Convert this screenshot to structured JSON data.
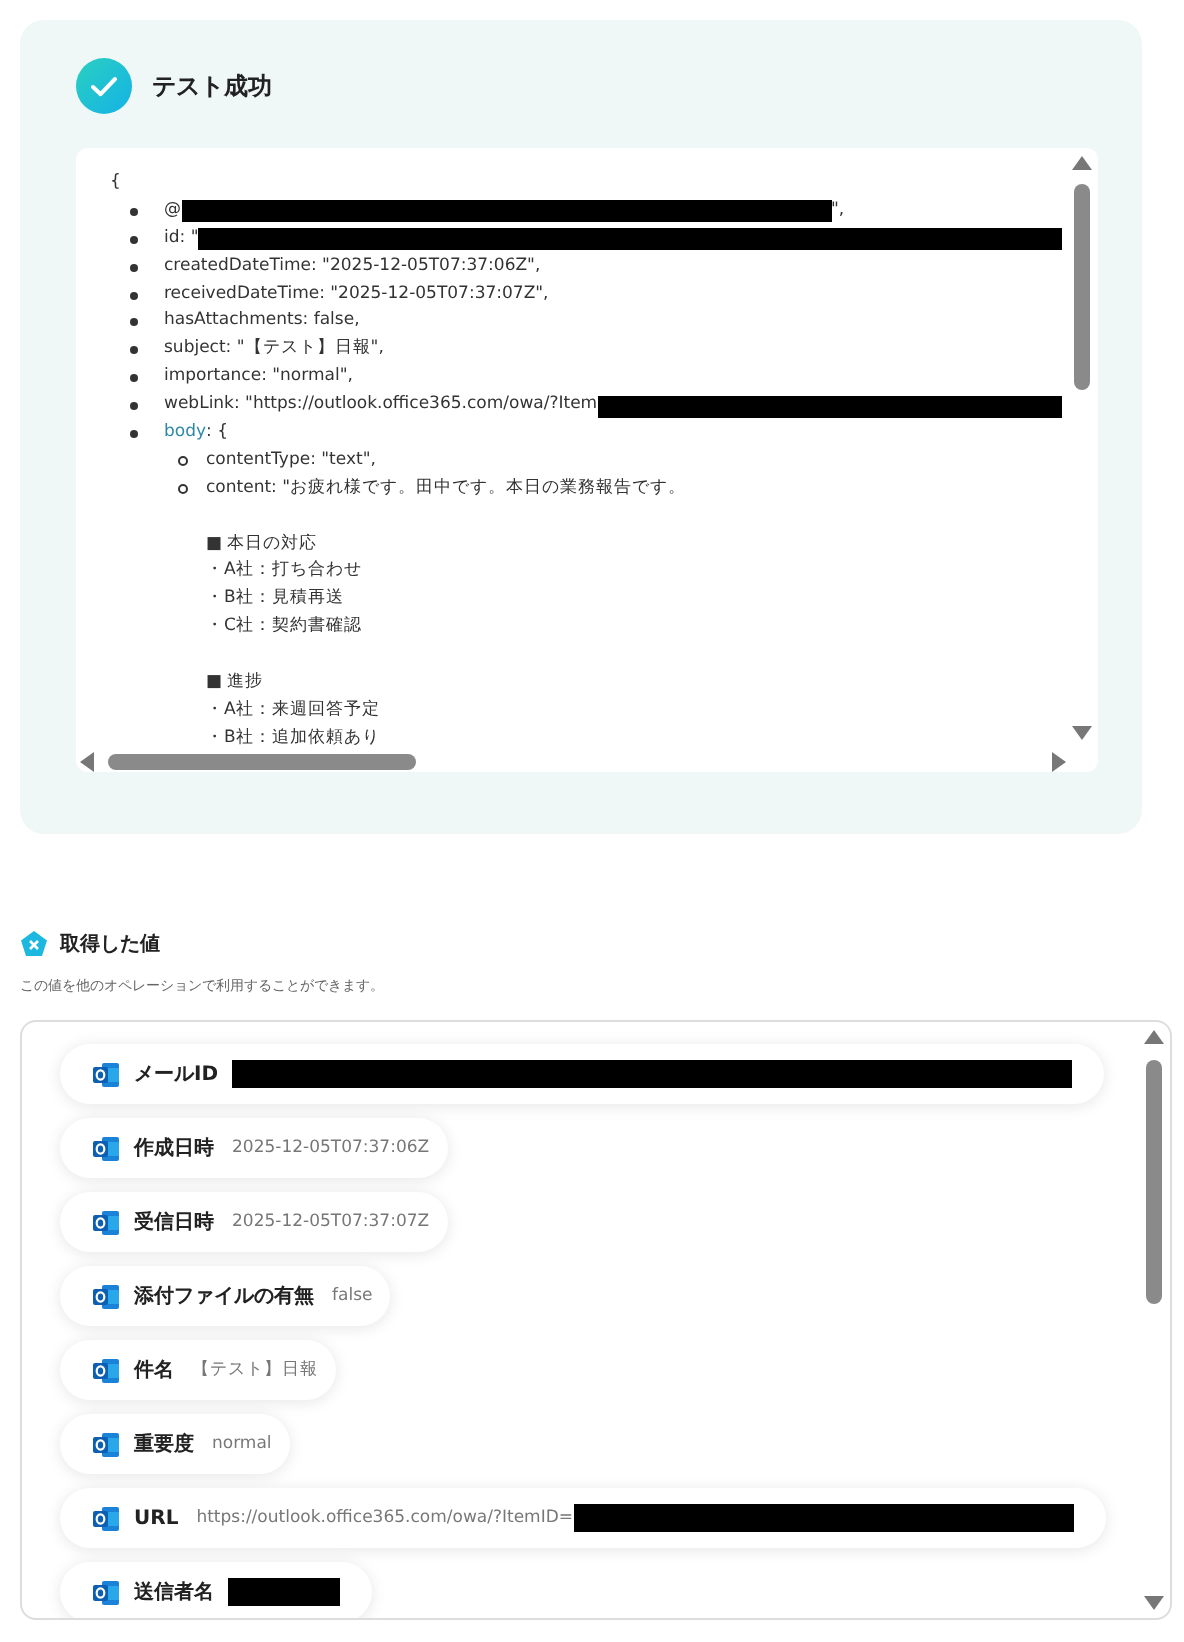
{
  "result": {
    "title": "テスト成功",
    "lines": [
      {
        "kind": "open",
        "text": "{"
      },
      {
        "kind": "item",
        "text": "@",
        "redacted": true,
        "after": "\","
      },
      {
        "kind": "item",
        "text": "id: \"",
        "redacted": true
      },
      {
        "kind": "item",
        "text": "createdDateTime: \"2025-12-05T07:37:06Z\","
      },
      {
        "kind": "item",
        "text": "receivedDateTime: \"2025-12-05T07:37:07Z\","
      },
      {
        "kind": "item",
        "text": "hasAttachments: false,"
      },
      {
        "kind": "item",
        "text": "subject: \"【テスト】日報\","
      },
      {
        "kind": "item",
        "text": "importance: \"normal\","
      },
      {
        "kind": "item",
        "text": "webLink: \"https://outlook.office365.com/owa/?Item",
        "redacted": true
      },
      {
        "kind": "item",
        "key": "body",
        "text": ": {"
      },
      {
        "kind": "subitem",
        "text": "contentType: \"text\","
      },
      {
        "kind": "subitem",
        "text": "content: \"お疲れ様です。田中です。本日の業務報告です。"
      },
      {
        "kind": "blank"
      },
      {
        "kind": "text",
        "text": "■ 本日の対応"
      },
      {
        "kind": "text",
        "text": "・A社：打ち合わせ"
      },
      {
        "kind": "text",
        "text": "・B社：見積再送"
      },
      {
        "kind": "text",
        "text": "・C社：契約書確認"
      },
      {
        "kind": "blank"
      },
      {
        "kind": "text",
        "text": "■ 進捗"
      },
      {
        "kind": "text",
        "text": "・A社：来週回答予定"
      },
      {
        "kind": "text",
        "text": "・B社：追加依頼あり"
      }
    ]
  },
  "values": {
    "title": "取得した値",
    "description": "この値を他のオペレーションで利用することができます。",
    "items": [
      {
        "label": "メールID",
        "redacted": true
      },
      {
        "label": "作成日時",
        "value": "2025-12-05T07:37:06Z"
      },
      {
        "label": "受信日時",
        "value": "2025-12-05T07:37:07Z"
      },
      {
        "label": "添付ファイルの有無",
        "value": "false"
      },
      {
        "label": "件名",
        "value": "【テスト】日報"
      },
      {
        "label": "重要度",
        "value": "normal"
      },
      {
        "label": "URL",
        "value": "https://outlook.office365.com/owa/?ItemID=",
        "redacted": true
      },
      {
        "label": "送信者名",
        "redacted": true
      }
    ]
  }
}
